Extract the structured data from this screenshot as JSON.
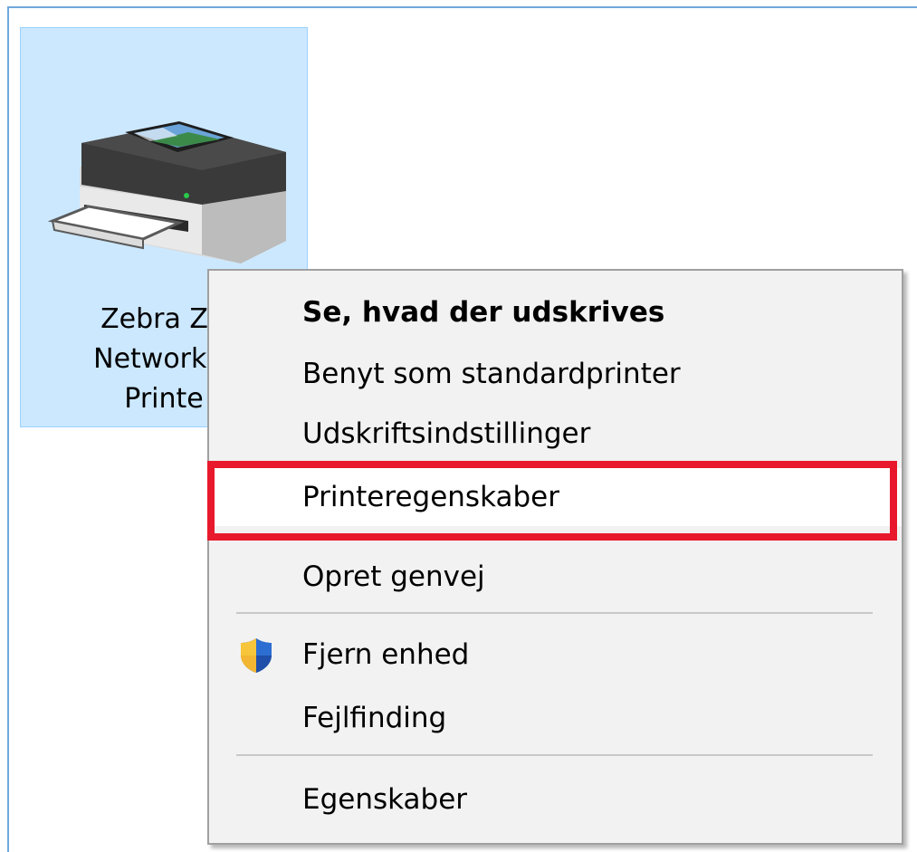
{
  "device": {
    "label_lines": [
      "Zebra ZC",
      "Network C",
      "Printe"
    ],
    "icon": "printer-icon"
  },
  "context_menu": {
    "items": [
      {
        "label": "Se, hvad der udskrives",
        "bold": true
      },
      {
        "label": "Benyt som standardprinter"
      },
      {
        "label": "Udskriftsindstillinger"
      },
      {
        "label": "Printeregenskaber",
        "highlighted": true
      },
      {
        "label": "Opret genvej"
      },
      {
        "label": "Fjern enhed",
        "icon": "uac-shield-icon"
      },
      {
        "label": "Fejlfinding"
      },
      {
        "label": "Egenskaber"
      }
    ]
  },
  "colors": {
    "selection_background": "#cce8ff",
    "selection_border": "#99d1ff",
    "menu_background": "#f2f2f2",
    "highlight_box": "#e8192c"
  }
}
